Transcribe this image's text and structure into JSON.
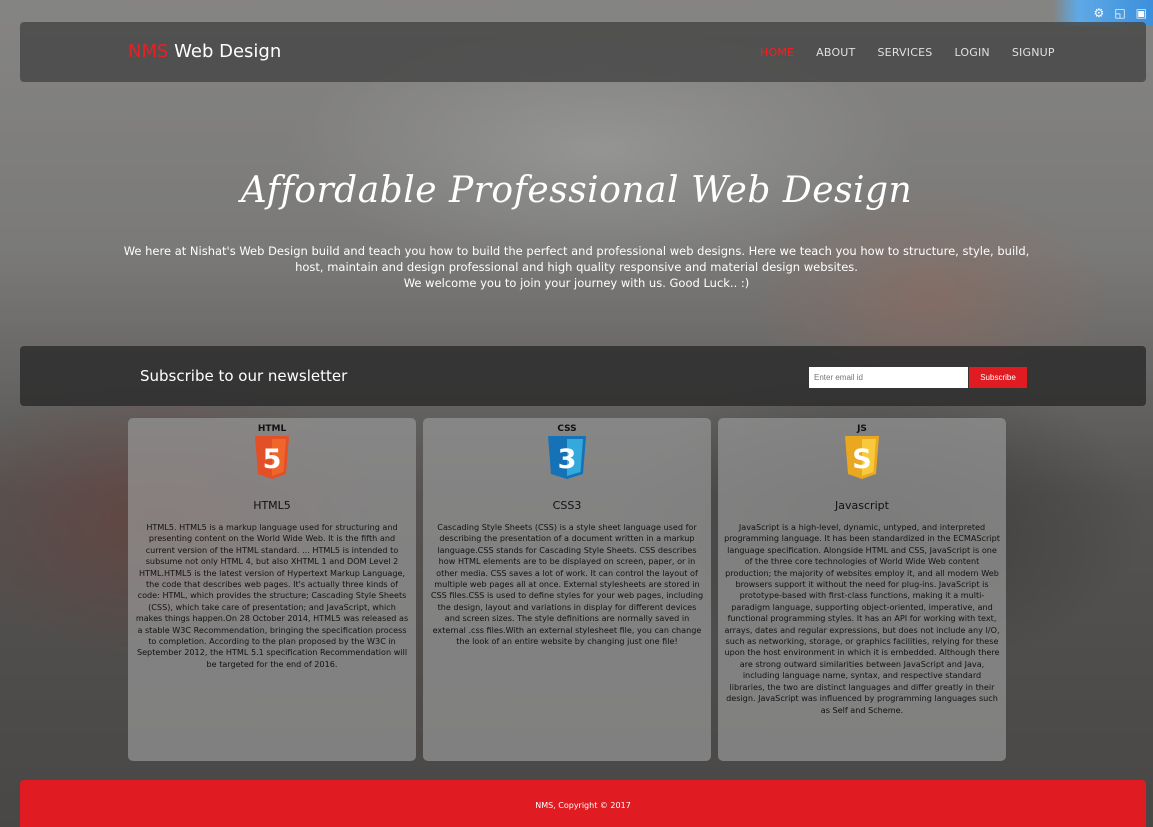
{
  "corner_widget": {
    "icons": [
      "⚙",
      "◱",
      "▣"
    ]
  },
  "navbar": {
    "brand_prefix": "NMS",
    "brand_suffix": " Web Design",
    "links": [
      {
        "label": "HOME",
        "active": true
      },
      {
        "label": "ABOUT",
        "active": false
      },
      {
        "label": "SERVICES",
        "active": false
      },
      {
        "label": "LOGIN",
        "active": false
      },
      {
        "label": "SIGNUP",
        "active": false
      }
    ]
  },
  "hero": {
    "title": "Affordable Professional Web Design",
    "line1": "We here at Nishat's Web Design build and teach you how to build the perfect and professional web designs. Here we teach you how to structure, style, build, host, maintain and design professional and high quality responsive and material design websites.",
    "line2": "We welcome you to join your journey with us. Good Luck.. :)"
  },
  "newsletter": {
    "title": "Subscribe to our newsletter",
    "email_placeholder": "Enter email id",
    "button_label": "Subscribe"
  },
  "cards": [
    {
      "logo_label": "HTML",
      "logo_number": "5",
      "logo_color": "#e34f26",
      "logo_light": "#f06529",
      "title": "HTML5",
      "text": "HTML5. HTML5 is a markup language used for structuring and presenting content on the World Wide Web. It is the fifth and current version of the HTML standard. ... HTML5 is intended to subsume not only HTML 4, but also XHTML 1 and DOM Level 2 HTML.HTML5 is the latest version of Hypertext Markup Language, the code that describes web pages. It's actually three kinds of code: HTML, which provides the structure; Cascading Style Sheets (CSS), which take care of presentation; and JavaScript, which makes things happen.On 28 October 2014, HTML5 was released as a stable W3C Recommendation, bringing the specification process to completion. According to the plan proposed by the W3C in September 2012, the HTML 5.1 specification Recommendation will be targeted for the end of 2016."
    },
    {
      "logo_label": "CSS",
      "logo_number": "3",
      "logo_color": "#1572b6",
      "logo_light": "#33a9dc",
      "title": "CSS3",
      "text": "Cascading Style Sheets (CSS) is a style sheet language used for describing the presentation of a document written in a markup language.CSS stands for Cascading Style Sheets. CSS describes how HTML elements are to be displayed on screen, paper, or in other media. CSS saves a lot of work. It can control the layout of multiple web pages all at once. External stylesheets are stored in CSS files.CSS is used to define styles for your web pages, including the design, layout and variations in display for different devices and screen sizes. The style definitions are normally saved in external .css files.With an external stylesheet file, you can change the look of an entire website by changing just one file!"
    },
    {
      "logo_label": "JS",
      "logo_number": "S",
      "logo_color": "#e9a820",
      "logo_light": "#f7c93b",
      "title": "Javascript",
      "text": "JavaScript is a high-level, dynamic, untyped, and interpreted programming language. It has been standardized in the ECMAScript language specification. Alongside HTML and CSS, JavaScript is one of the three core technologies of World Wide Web content production; the majority of websites employ it, and all modern Web browsers support it without the need for plug-ins. JavaScript is prototype-based with first-class functions, making it a multi-paradigm language, supporting object-oriented, imperative, and functional programming styles. It has an API for working with text, arrays, dates and regular expressions, but does not include any I/O, such as networking, storage, or graphics facilities, relying for these upon the host environment in which it is embedded. Although there are strong outward similarities between JavaScript and Java, including language name, syntax, and respective standard libraries, the two are distinct languages and differ greatly in their design. JavaScript was influenced by programming languages such as Self and Scheme."
    }
  ],
  "footer": {
    "text": "NMS, Copyright © 2017"
  },
  "colors": {
    "accent": "#e11b22"
  }
}
